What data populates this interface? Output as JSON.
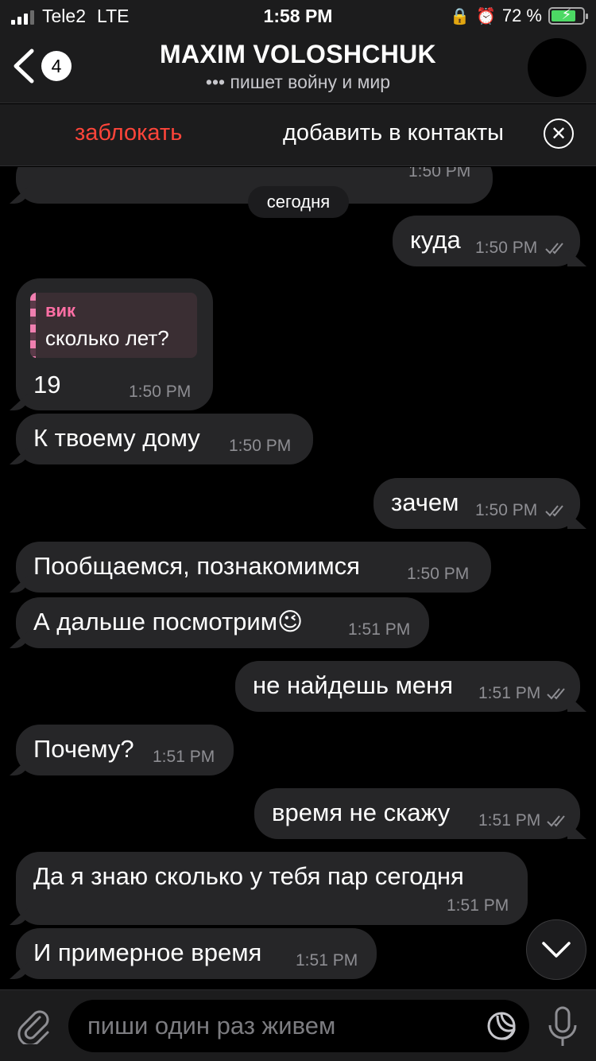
{
  "status": {
    "carrier": "Tele2",
    "network": "LTE",
    "time": "1:58 PM",
    "battery": "72 %"
  },
  "header": {
    "unread_count": "4",
    "title": "MAXIM VOLOSHCHUK",
    "typing": "••• пишет войну и мир"
  },
  "actions": {
    "block": "заблокать",
    "add": "добавить в контакты"
  },
  "date_label": "сегодня",
  "messages": [
    {
      "dir": "in",
      "text": "",
      "time": "1:50 PM"
    },
    {
      "dir": "out",
      "text": "куда",
      "time": "1:50 PM"
    },
    {
      "dir": "in",
      "reply_name": "вик",
      "reply_text": "сколько лет?",
      "text": "19",
      "time": "1:50 PM"
    },
    {
      "dir": "in",
      "text": "К твоему дому",
      "time": "1:50 PM"
    },
    {
      "dir": "out",
      "text": "зачем",
      "time": "1:50 PM"
    },
    {
      "dir": "in",
      "text": "Пообщаемся, познакомимся",
      "time": "1:50 PM"
    },
    {
      "dir": "in",
      "text": "А дальше посмотрим😉",
      "time": "1:51 PM"
    },
    {
      "dir": "out",
      "text": "не найдешь меня",
      "time": "1:51 PM"
    },
    {
      "dir": "in",
      "text": "Почему?",
      "time": "1:51 PM"
    },
    {
      "dir": "out",
      "text": "время не скажу",
      "time": "1:51 PM"
    },
    {
      "dir": "in",
      "text": "Да я знаю сколько у тебя пар сегодня",
      "time": "1:51 PM"
    },
    {
      "dir": "in",
      "text": "И примерное время",
      "time": "1:51 PM"
    }
  ],
  "input": {
    "placeholder": "пиши один раз живем"
  },
  "colors": {
    "background": "#000000",
    "bubble": "#262628",
    "danger": "#ff453a",
    "reply_accent": "#ff6fa5"
  },
  "icons": [
    "back-chevron-icon",
    "close-circle-icon",
    "double-check-icon",
    "scroll-down-icon",
    "attach-icon",
    "sticker-icon",
    "mic-icon"
  ]
}
